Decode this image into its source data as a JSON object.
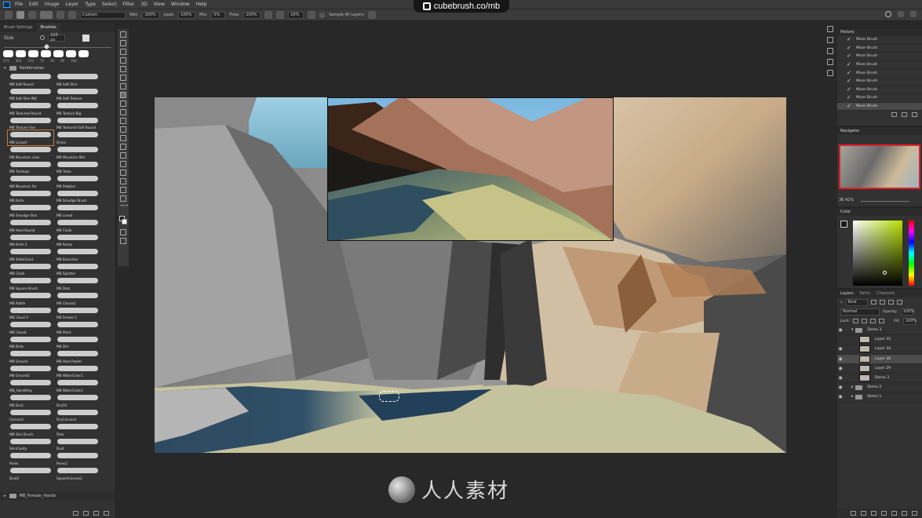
{
  "menu": [
    "File",
    "Edit",
    "Image",
    "Layer",
    "Type",
    "Select",
    "Filter",
    "3D",
    "View",
    "Window",
    "Help"
  ],
  "watermark": {
    "text": "cubebrush.co/mb"
  },
  "options": {
    "preset": "Custom",
    "wet_label": "Wet:",
    "wet": "100%",
    "load_label": "Load:",
    "load": "100%",
    "mix_label": "Mix:",
    "mix": "0%",
    "flow_label": "Flow:",
    "flow": "100%",
    "smoothing": "10%",
    "sample_all_layers": "Sample All Layers"
  },
  "brush_panel": {
    "tabs": [
      "Brush Settings",
      "Brushes"
    ],
    "size_label": "Size",
    "size_value": "225 px",
    "preset_sizes": [
      "275",
      "300",
      "150",
      "70",
      "36",
      "90",
      "260"
    ],
    "group_name": "Hardbrushes",
    "footer_group": "MB_Female_Hands",
    "brushes": [
      "MB Soft Round",
      "MB Soft Slim",
      "MB Soft Slim BW",
      "MB Soft Texture",
      "MB Textured Round",
      "MB Texture Big",
      "MB Texture Fine",
      "MB Textured Soft Round",
      "MB Linoart",
      "Grass",
      "MB Mountain claw",
      "MB Mountain Mid",
      "MB Treetops",
      "MB Trees",
      "MB Mountain Far",
      "MB Pebbles",
      "MB Knife",
      "MB Smudge Brush",
      "MB Smudge Skin",
      "MB Lineal",
      "MB Hard Round",
      "MB Chalk",
      "MB Knife 2",
      "MB Rocky",
      "MB SlideCloud",
      "MB Branches",
      "MB Chalk",
      "MB Splatter",
      "MB Square Brush",
      "MB Dots",
      "MB Rattle",
      "MB Clouds2",
      "MB Cloud 3",
      "MB Smoke 1",
      "MB Clouds",
      "MB Plant",
      "MB Birds",
      "MB Dirt",
      "MB Ground",
      "MB Hard Pastel",
      "MB Ground2",
      "MB WaterColor1",
      "MB_HandAmy",
      "MB WaterColor2",
      "MB Dust",
      "DryOil",
      "Canvas2",
      "DryCanvas1",
      "MB Skin Brush",
      "Filler",
      "SkinCavity",
      "Dust",
      "Pores",
      "Pores2",
      "Dust2",
      "SquareCanvas2"
    ],
    "selected_index": 8
  },
  "history": {
    "title": "History",
    "items": [
      "Mixer Brush",
      "Mixer Brush",
      "Mixer Brush",
      "Mixer Brush",
      "Mixer Brush",
      "Mixer Brush",
      "Mixer Brush",
      "Mixer Brush",
      "Mixer Brush"
    ]
  },
  "navigator": {
    "title": "Navigator",
    "zoom": "36.42%"
  },
  "color": {
    "title": "Color",
    "foreground": "#1a1a1a",
    "background": "#ffffff"
  },
  "layers": {
    "tabs": [
      "Layers",
      "Paths",
      "Channels"
    ],
    "kind_label": "Kind",
    "blend_mode": "Normal",
    "opacity_label": "Opacity:",
    "opacity": "100%",
    "lock_label": "Lock:",
    "fill_label": "Fill:",
    "fill": "100%",
    "rows": [
      {
        "name": "Demo 3",
        "type": "group",
        "indent": 0,
        "visible": true
      },
      {
        "name": "Layer 35",
        "type": "layer",
        "indent": 1,
        "visible": false
      },
      {
        "name": "Layer 34",
        "type": "layer",
        "indent": 1,
        "visible": true
      },
      {
        "name": "Layer 36",
        "type": "layer",
        "indent": 1,
        "visible": true,
        "selected": true
      },
      {
        "name": "Layer 29",
        "type": "layer",
        "indent": 1,
        "visible": true
      },
      {
        "name": "Demo 3",
        "type": "layer",
        "indent": 1,
        "visible": true
      },
      {
        "name": "Demo 2",
        "type": "group",
        "indent": 0,
        "visible": true
      },
      {
        "name": "Demo 1",
        "type": "group",
        "indent": 0,
        "visible": true
      }
    ]
  },
  "bottom_logo": {
    "text": "人人素材"
  }
}
